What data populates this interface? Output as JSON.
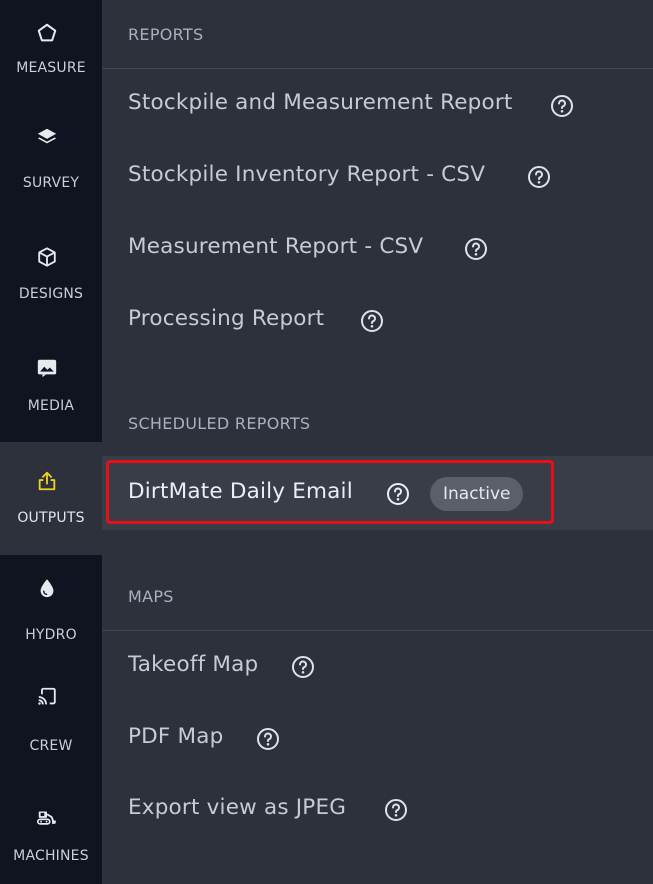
{
  "nav": {
    "items": [
      {
        "label": "MEASURE",
        "icon": "pentagon-icon"
      },
      {
        "label": "SURVEY",
        "icon": "layers-icon"
      },
      {
        "label": "DESIGNS",
        "icon": "cube-icon"
      },
      {
        "label": "MEDIA",
        "icon": "image-icon"
      },
      {
        "label": "OUTPUTS",
        "icon": "share-upload-icon",
        "active": true
      },
      {
        "label": "HYDRO",
        "icon": "water-drop-icon"
      },
      {
        "label": "CREW",
        "icon": "cast-device-icon"
      },
      {
        "label": "MACHINES",
        "icon": "excavator-icon"
      }
    ],
    "active_color": "#f2d022"
  },
  "sections": {
    "reports": {
      "header": "REPORTS",
      "items": [
        {
          "label": "Stockpile and Measurement Report"
        },
        {
          "label": "Stockpile Inventory Report - CSV"
        },
        {
          "label": "Measurement Report - CSV"
        },
        {
          "label": "Processing Report"
        }
      ]
    },
    "scheduled": {
      "header": "SCHEDULED REPORTS",
      "items": [
        {
          "label": "DirtMate Daily Email",
          "badge": "Inactive"
        }
      ]
    },
    "maps": {
      "header": "MAPS",
      "items": [
        {
          "label": "Takeoff Map"
        },
        {
          "label": "PDF Map"
        },
        {
          "label": "Export view as JPEG"
        }
      ]
    }
  },
  "highlight_color": "#e5101a"
}
